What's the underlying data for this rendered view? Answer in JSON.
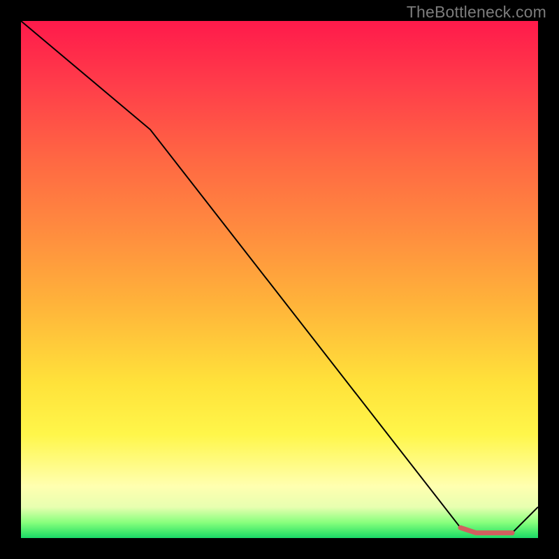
{
  "watermark": "TheBottleneck.com",
  "chart_data": {
    "type": "line",
    "title": "",
    "xlabel": "",
    "ylabel": "",
    "xlim": [
      0,
      100
    ],
    "ylim": [
      0,
      100
    ],
    "series": [
      {
        "name": "curve",
        "stroke": "#000000",
        "stroke_width": 2,
        "x": [
          0,
          25,
          85,
          88,
          95,
          100
        ],
        "y": [
          100,
          79,
          2,
          1,
          1,
          6
        ]
      },
      {
        "name": "highlight",
        "stroke": "#d1605f",
        "stroke_width": 7,
        "linecap": "round",
        "x": [
          85,
          88,
          95
        ],
        "y": [
          2,
          1,
          1
        ]
      }
    ],
    "colors": {
      "gradient_top": "#ff1a4b",
      "gradient_mid": "#ffe23a",
      "gradient_bottom": "#1bd968",
      "background": "#000000",
      "watermark": "#7c7c7c"
    }
  }
}
